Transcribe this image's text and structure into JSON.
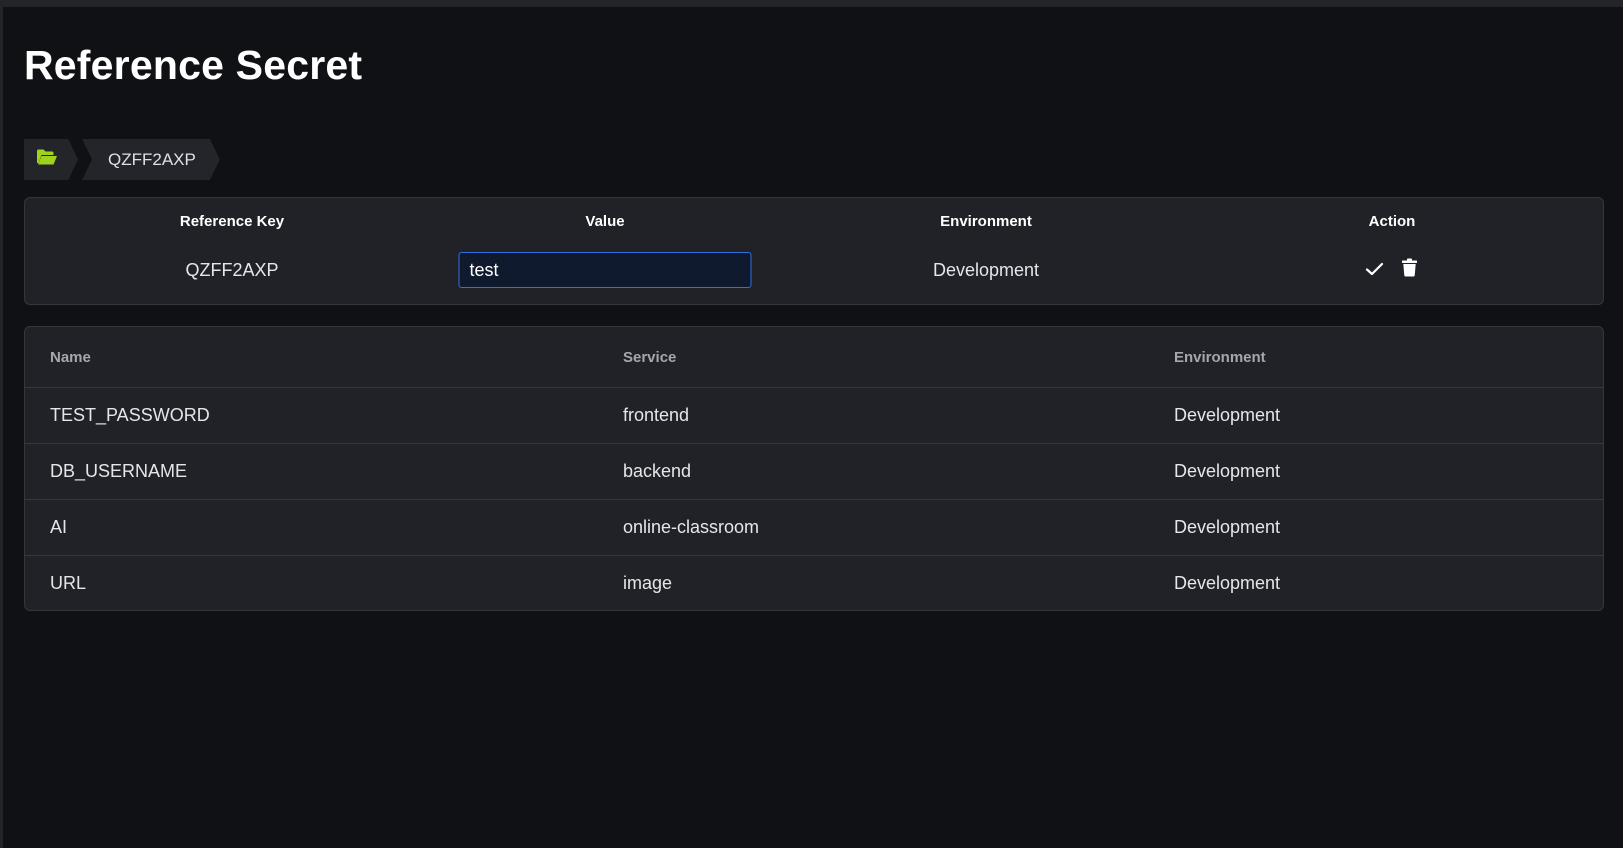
{
  "page": {
    "title": "Reference Secret"
  },
  "breadcrumb": {
    "home_icon": "folder-open-icon",
    "icon_color": "#9fd21f",
    "items": [
      "QZFF2AXP"
    ]
  },
  "reference_table": {
    "headers": {
      "key": "Reference Key",
      "value": "Value",
      "environment": "Environment",
      "action": "Action"
    },
    "row": {
      "key": "QZFF2AXP",
      "value": "test",
      "environment": "Development",
      "actions": [
        "check-icon",
        "trash-icon"
      ]
    }
  },
  "secrets_table": {
    "headers": {
      "name": "Name",
      "service": "Service",
      "environment": "Environment"
    },
    "rows": [
      {
        "name": "TEST_PASSWORD",
        "service": "frontend",
        "environment": "Development"
      },
      {
        "name": "DB_USERNAME",
        "service": "backend",
        "environment": "Development"
      },
      {
        "name": "AI",
        "service": "online-classroom",
        "environment": "Development"
      },
      {
        "name": "URL",
        "service": "image",
        "environment": "Development"
      }
    ]
  },
  "colors": {
    "background": "#101115",
    "card": "#202227",
    "input_border": "#2f6fe0",
    "accent_icon": "#9fd21f"
  }
}
